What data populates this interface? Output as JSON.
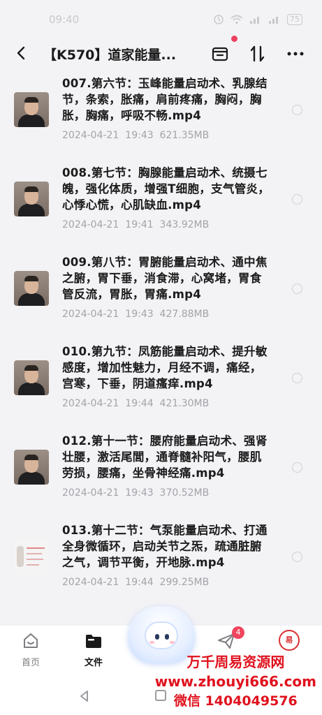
{
  "status_bar": {
    "time": "09:40",
    "battery": "75"
  },
  "header": {
    "title": "【K570】道家能量..."
  },
  "files": [
    {
      "name": "007.第六节：玉峰能量启动术、乳腺结节，条索，胀痛，肩前疼痛，胸闷，胸胀，胸痛，呼吸不畅.mp4",
      "date": "2024-04-21",
      "time": "19:43",
      "size": "621.35MB",
      "thumb": "person"
    },
    {
      "name": "008.第七节：胸腺能量启动术、统摄七魄，强化体质，增强T细胞，支气管炎，心悸心慌，心肌缺血.mp4",
      "date": "2024-04-21",
      "time": "19:41",
      "size": "343.92MB",
      "thumb": "person"
    },
    {
      "name": "009.第八节：胃腑能量启动术、通中焦之腑，胃下垂，消食滞，心窝堵，胃食管反流，胃胀，胃痛.mp4",
      "date": "2024-04-21",
      "time": "19:43",
      "size": "427.88MB",
      "thumb": "person"
    },
    {
      "name": "010.第九节：凤筋能量启动术、提升敏感度，增加性魅力，月经不调，痛经，宫寒，下垂，阴道瘙痒.mp4",
      "date": "2024-04-21",
      "time": "19:44",
      "size": "421.30MB",
      "thumb": "person"
    },
    {
      "name": "012.第十一节：腰府能量启动术、强肾壮腰，激活尾閭，通脊髓补阳气，腰肌劳损，腰痛，坐骨神经痛.mp4",
      "date": "2024-04-21",
      "time": "19:43",
      "size": "370.52MB",
      "thumb": "person"
    },
    {
      "name": "013.第十二节：气泵能量启动术、打通全身微循环，启动关节之炁，疏通脏腑之气，调节平衡，开地脉.mp4",
      "date": "2024-04-21",
      "time": "19:44",
      "size": "299.25MB",
      "thumb": "doc"
    }
  ],
  "bottom_nav": {
    "home_label": "首页",
    "files_label": "文件",
    "send_badge": "4"
  },
  "watermark": {
    "line1": "万千周易资源网",
    "line2": "www.zhouyi666.com",
    "line3": "微信 1404049576"
  },
  "colors": {
    "accent_red": "#ee3f5e",
    "watermark_red": "#e0121e"
  }
}
